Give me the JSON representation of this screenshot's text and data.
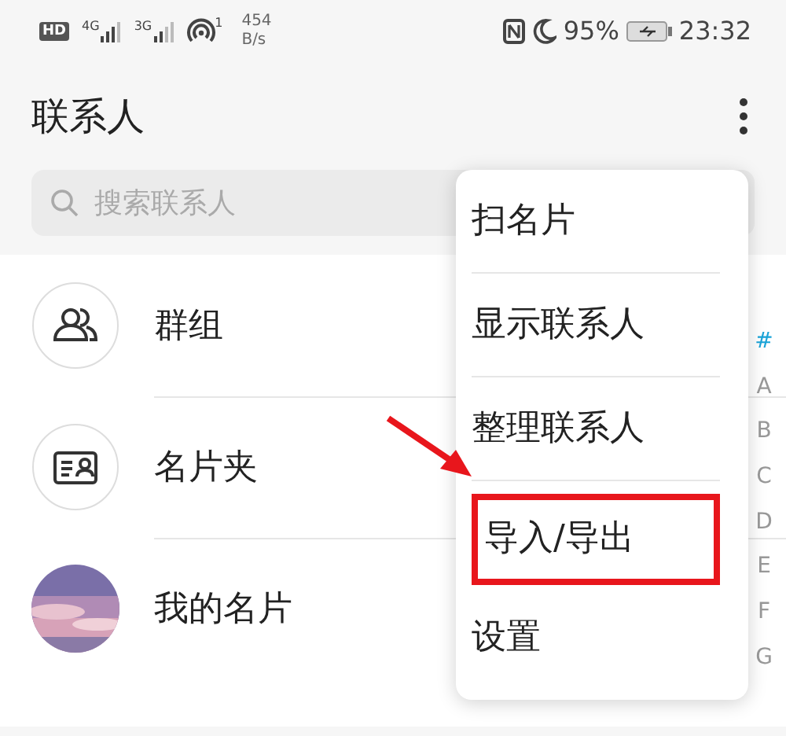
{
  "status_bar": {
    "left": [
      {
        "kind": "badge",
        "text": "HD"
      },
      {
        "kind": "signal",
        "text": "4G"
      },
      {
        "kind": "signal",
        "text": "3G"
      },
      {
        "kind": "hotspot",
        "text": "1"
      },
      {
        "kind": "speed",
        "text": "454",
        "unit": "B/s"
      }
    ],
    "right": [
      {
        "kind": "nfc"
      },
      {
        "kind": "moon"
      },
      {
        "kind": "text",
        "text": "95%"
      },
      {
        "kind": "battery"
      },
      {
        "kind": "text",
        "text": "23:32"
      }
    ]
  },
  "header": {
    "title": "联系人"
  },
  "search": {
    "placeholder": "搜索联系人"
  },
  "list": [
    {
      "kind": "group",
      "label": "群组"
    },
    {
      "kind": "card",
      "label": "名片夹"
    },
    {
      "kind": "picture",
      "label": "我的名片"
    }
  ],
  "index": [
    {
      "label": "#",
      "selected": true
    },
    {
      "label": "A",
      "selected": false
    },
    {
      "label": "B",
      "selected": false
    },
    {
      "label": "C",
      "selected": false
    },
    {
      "label": "D",
      "selected": false
    },
    {
      "label": "E",
      "selected": false
    },
    {
      "label": "F",
      "selected": false
    },
    {
      "label": "G",
      "selected": false
    }
  ],
  "menu": [
    {
      "label": "扫名片",
      "highlighted": false
    },
    {
      "label": "显示联系人",
      "highlighted": false
    },
    {
      "label": "整理联系人",
      "highlighted": false
    },
    {
      "label": "导入/导出",
      "highlighted": true
    },
    {
      "label": "设置",
      "highlighted": false
    }
  ]
}
